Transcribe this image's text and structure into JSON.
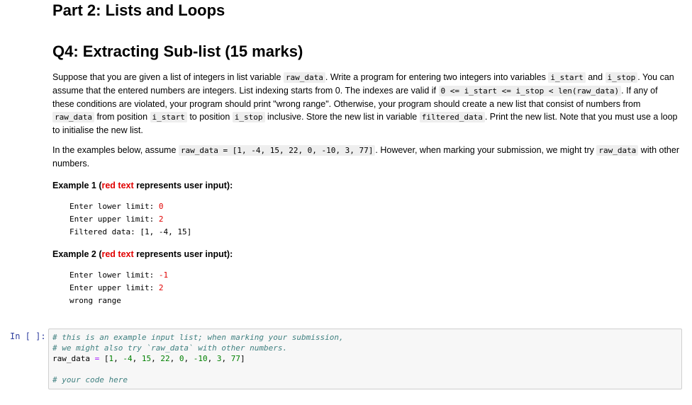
{
  "part_title": "Part 2: Lists and Loops",
  "question_title": "Q4: Extracting Sub-list (15 marks)",
  "p1": {
    "t1": "Suppose that you are given a list of integers in list variable ",
    "c1": "raw_data",
    "t2": ". Write a program for entering two integers into variables ",
    "c2": "i_start",
    "t3": " and ",
    "c3": "i_stop",
    "t4": ". You can assume that the entered numbers are integers. List indexing starts from 0. The indexes are valid if ",
    "c4": "0 <= i_start <= i_stop < len(raw_data)",
    "t5": ". If any of these conditions are violated, your program should print \"wrong range\". Otherwise, your program should create a new list that consist of numbers from ",
    "c5": "raw_data",
    "t6": " from position ",
    "c6": "i_start",
    "t7": " to position ",
    "c7": "i_stop",
    "t8": " inclusive. Store the new list in variable ",
    "c8": "filtered_data",
    "t9": ". Print the new list. Note that you must use a loop to initialise the new list."
  },
  "p2": {
    "t1": "In the examples below, assume ",
    "c1": "raw_data = [1, -4, 15, 22, 0, -10, 3, 77]",
    "t2": ". However, when marking your submission, we might try ",
    "c2": "raw_data",
    "t3": " with other numbers."
  },
  "example1": {
    "prefix": "Example 1 (",
    "red": "red text",
    "suffix": " represents user input):",
    "lines": [
      {
        "prompt": "Enter lower limit: ",
        "input": "0"
      },
      {
        "prompt": "Enter upper limit: ",
        "input": "2"
      },
      {
        "prompt": "Filtered data: [1, -4, 15]",
        "input": ""
      }
    ]
  },
  "example2": {
    "prefix": "Example 2 (",
    "red": "red text",
    "suffix": " represents user input):",
    "lines": [
      {
        "prompt": "Enter lower limit: ",
        "input": "-1"
      },
      {
        "prompt": "Enter upper limit: ",
        "input": "2"
      },
      {
        "prompt": "wrong range",
        "input": ""
      }
    ]
  },
  "cell": {
    "prompt": "In [ ]:",
    "comment1": "# this is an example input list; when marking your submission,",
    "comment2": "# we might also try `raw_data` with other numbers.",
    "var": "raw_data ",
    "eq": "=",
    "list_open": " [",
    "list_nums": [
      "1",
      "-4",
      "15",
      "22",
      "0",
      "-10",
      "3",
      "77"
    ],
    "list_close": "]",
    "comment3": "# your code here"
  }
}
